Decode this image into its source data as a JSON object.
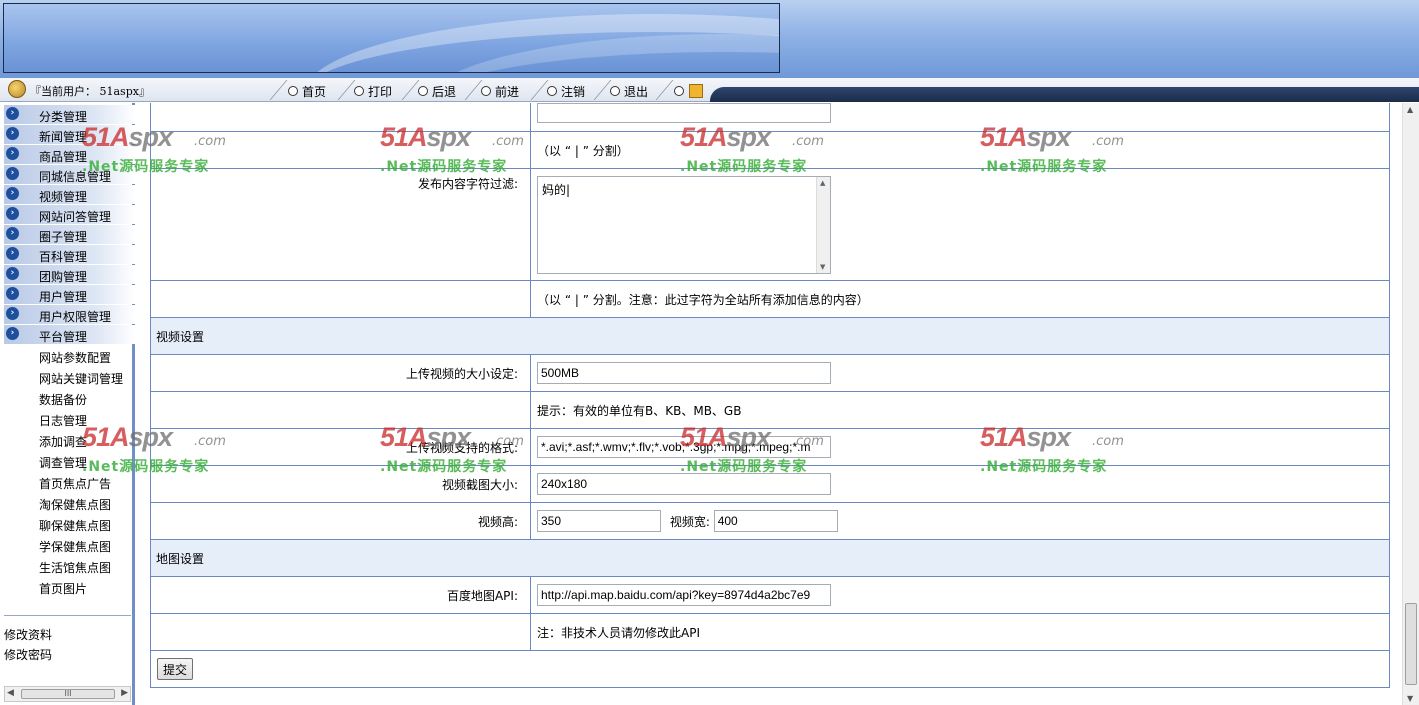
{
  "toolbar": {
    "user_label": "『当前用户： 51aspx』",
    "buttons": [
      "首页",
      "打印",
      "后退",
      "前进",
      "注销",
      "退出"
    ]
  },
  "sidebar": {
    "menu": [
      "分类管理",
      "新闻管理",
      "商品管理",
      "同城信息管理",
      "视频管理",
      "网站问答管理",
      "圈子管理",
      "百科管理",
      "团购管理",
      "用户管理",
      "用户权限管理",
      "平台管理"
    ],
    "sub_menu": [
      "网站参数配置",
      "网站关键词管理",
      "数据备份",
      "日志管理",
      "添加调查",
      "调查管理",
      "首页焦点广告",
      "淘保健焦点图",
      "聊保健焦点图",
      "学保健焦点图",
      "生活馆焦点图",
      "首页图片"
    ],
    "bottom": [
      "修改资料",
      "修改密码"
    ],
    "scroll_thumb": "III"
  },
  "form": {
    "hint_split": "（以 “ | ” 分割）",
    "filter_label": "发布内容字符过滤:",
    "filter_value": "妈的|",
    "hint_filter": "（以 “ | ” 分割。注意：此过字符为全站所有添加信息的内容）",
    "video_section": "视频设置",
    "video_size_label": "上传视频的大小设定:",
    "video_size_value": "500MB",
    "video_size_hint": "提示：有效的单位有B、KB、MB、GB",
    "video_formats_label": "上传视频支持的格式:",
    "video_formats_value": "*.avi;*.asf;*.wmv;*.flv;*.vob;*.3gp;*.mpg;*.mpeg;*.m",
    "thumb_size_label": "视频截图大小:",
    "thumb_size_value": "240x180",
    "video_height_label": "视频高:",
    "video_height_value": "350",
    "video_width_label": "视频宽:",
    "video_width_value": "400",
    "map_section": "地图设置",
    "map_api_label": "百度地图API:",
    "map_api_value": "http://api.map.baidu.com/api?key=8974d4a2bc7e9",
    "map_api_hint": "注：非技术人员请勿修改此API",
    "submit_label": "提交"
  },
  "watermark": {
    "brand_51": "51A",
    "brand_spx": "spx",
    "brand_com": ".com",
    "tagline": ".Net源码服务专家"
  }
}
